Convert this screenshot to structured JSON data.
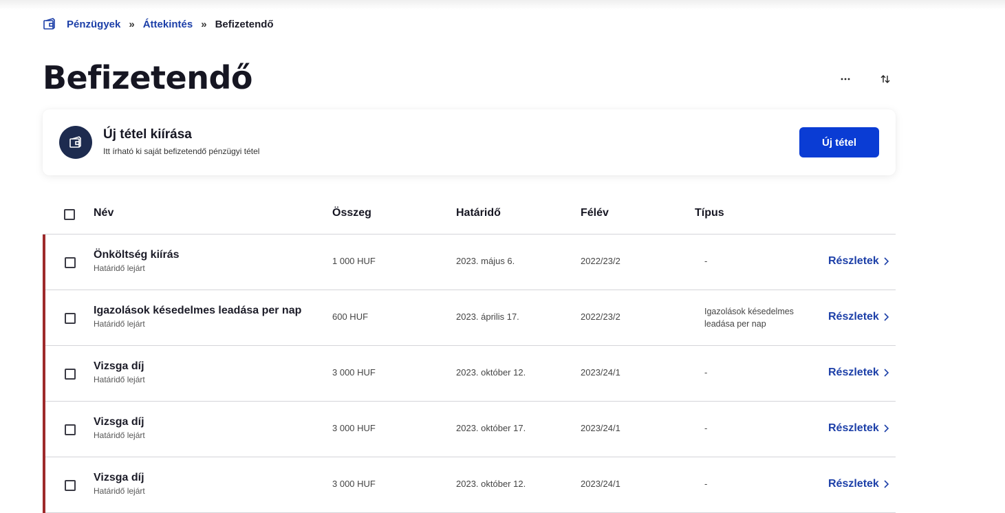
{
  "breadcrumb": {
    "items": [
      "Pénzügyek",
      "Áttekintés"
    ],
    "current": "Befizetendő",
    "separator": "»"
  },
  "page": {
    "title": "Befizetendő",
    "more_icon": "…",
    "sort_icon": "⇅"
  },
  "card": {
    "title": "Új tétel kiírása",
    "subtitle": "Itt írható ki saját befizetendő pénzügyi tétel",
    "button_label": "Új tétel"
  },
  "table": {
    "headers": {
      "name": "Név",
      "amount": "Összeg",
      "deadline": "Határidő",
      "semester": "Félév",
      "type": "Típus"
    },
    "rows": [
      {
        "name": "Önköltség kiírás",
        "status": "Határidő lejárt",
        "amount": "1 000 HUF",
        "deadline": "2023. május 6.",
        "semester": "2022/23/2",
        "type": "-",
        "details": "Részletek"
      },
      {
        "name": "Igazolások késedelmes leadása per nap",
        "status": "Határidő lejárt",
        "amount": "600 HUF",
        "deadline": "2023. április 17.",
        "semester": "2022/23/2",
        "type": "Igazolások késedelmes leadása per nap",
        "details": "Részletek"
      },
      {
        "name": "Vizsga díj",
        "status": "Határidő lejárt",
        "amount": "3 000 HUF",
        "deadline": "2023. október 12.",
        "semester": "2023/24/1",
        "type": "-",
        "details": "Részletek"
      },
      {
        "name": "Vizsga díj",
        "status": "Határidő lejárt",
        "amount": "3 000 HUF",
        "deadline": "2023. október 17.",
        "semester": "2023/24/1",
        "type": "-",
        "details": "Részletek"
      },
      {
        "name": "Vizsga díj",
        "status": "Határidő lejárt",
        "amount": "3 000 HUF",
        "deadline": "2023. október 12.",
        "semester": "2023/24/1",
        "type": "-",
        "details": "Részletek"
      }
    ]
  },
  "colors": {
    "accent": "#0a3cd4",
    "link": "#1c3fa8",
    "overdue_flag": "#9e2a2b",
    "icon_circle": "#1d2b4f"
  }
}
